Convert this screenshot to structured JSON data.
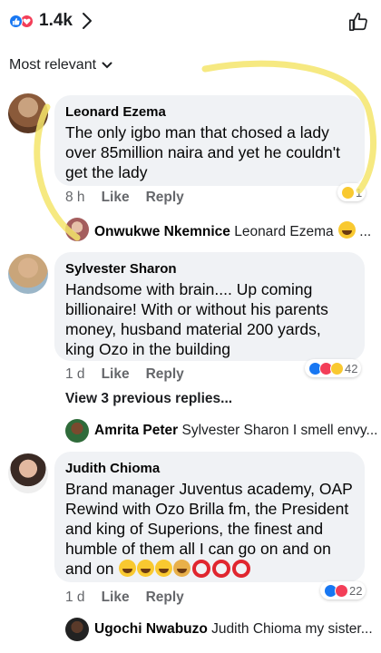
{
  "header": {
    "reaction_count": "1.4k",
    "colors": {
      "like": "#1877f2",
      "love": "#f33e58"
    }
  },
  "sort": {
    "label": "Most relevant"
  },
  "comments": [
    {
      "author": "Leonard Ezema",
      "text": "The only igbo man that chosed a lady over 85million naira and yet he couldn't get the lady",
      "time": "8 h",
      "like_label": "Like",
      "reply_label": "Reply",
      "reaction_count": "1",
      "reply": {
        "author": "Onwukwe Nkemnice",
        "text": "Leonard Ezema",
        "trail": "..."
      }
    },
    {
      "author": "Sylvester Sharon",
      "text": "Handsome with brain.... Up coming billionaire! With or without his parents money, husband material 200 yards, king Ozo in the building",
      "time": "1 d",
      "like_label": "Like",
      "reply_label": "Reply",
      "reaction_count": "42",
      "view_previous": "View 3 previous replies...",
      "reply": {
        "author": "Amrita Peter",
        "text": "Sylvester Sharon I smell envy..."
      }
    },
    {
      "author": "Judith Chioma",
      "text": "Brand manager Juventus academy, OAP Rewind with Ozo Brilla fm, the President and king of  Superions, the finest and humble of them all I can go on and on and on",
      "time": "1 d",
      "like_label": "Like",
      "reply_label": "Reply",
      "reaction_count": "22",
      "reply": {
        "author": "Ugochi Nwabuzo",
        "text": "Judith Chioma my sister..."
      }
    }
  ]
}
